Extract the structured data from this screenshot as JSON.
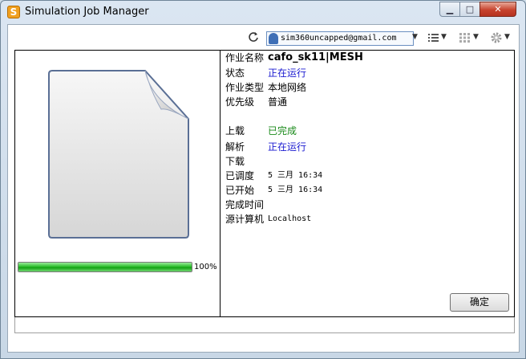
{
  "window": {
    "title": "Simulation Job Manager",
    "app_icon_letter": "S",
    "minimize_glyph": "▁",
    "maximize_glyph": "□",
    "close_glyph": "✕"
  },
  "toolbar": {
    "refresh_icon": "refresh-icon",
    "account_email": "sim360uncapped@gmail.com",
    "list_icon": "list-icon",
    "grid_icon": "grid-icon",
    "settings_icon": "gear-icon"
  },
  "job": {
    "name_label": "作业名称",
    "name_value": "cafo_sk11|MESH",
    "status_label": "状态",
    "status_value": "正在运行",
    "type_label": "作业类型",
    "type_value": "本地网络",
    "priority_label": "优先级",
    "priority_value": "普通",
    "upload_label": "上载",
    "upload_value": "已完成",
    "parse_label": "解析",
    "parse_value": "正在运行",
    "download_label": "下载",
    "scheduled_label": "已调度",
    "scheduled_value": "5 三月 16:34",
    "started_label": "已开始",
    "started_value": "5 三月 16:34",
    "finished_label": "完成时间",
    "source_label": "源计算机",
    "source_value": "Localhost"
  },
  "progress": {
    "percent": 100,
    "label": "100%"
  },
  "ok_button": "确定",
  "colors": {
    "running": "#1a1ad0",
    "completed": "#1a8a1a",
    "progress": "#13a013"
  }
}
